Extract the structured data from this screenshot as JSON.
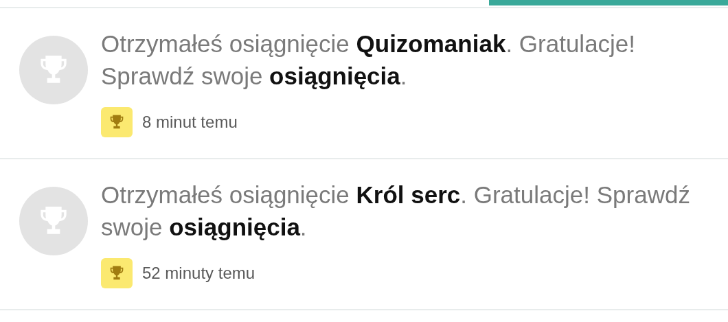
{
  "notifications": [
    {
      "message": "Otrzymałeś osiągnięcie **Quizomaniak**. Gratulacje! Sprawdź swoje **osiągnięcia**.",
      "time": "8 minut temu"
    },
    {
      "message": "Otrzymałeś osiągnięcie **Król serc**. Gratulacje! Sprawdź swoje **osiągnięcia**.",
      "time": "52 minuty temu"
    }
  ]
}
